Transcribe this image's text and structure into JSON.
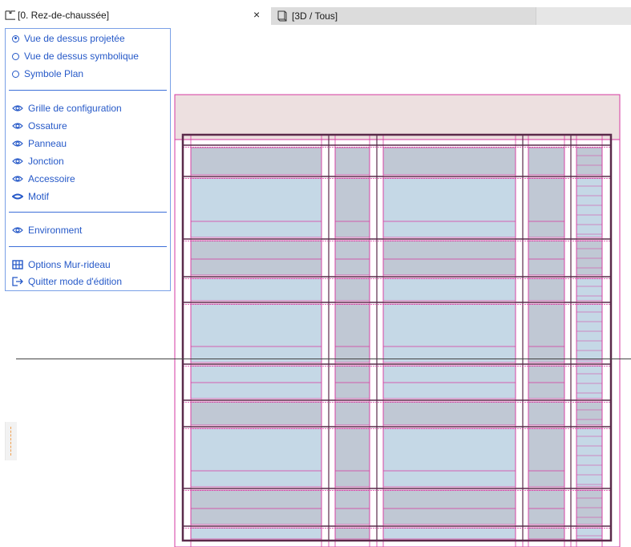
{
  "tabs": {
    "plan_label": "[0. Rez-de-chaussée]",
    "close_glyph": "×",
    "view3d_label": "[3D / Tous]",
    "plan_icon": "floor-plan-icon",
    "view3d_icon": "3d-window-icon"
  },
  "panel": {
    "view_options": [
      {
        "label": "Vue de dessus projetée",
        "selected": true
      },
      {
        "label": "Vue de dessus symbolique",
        "selected": false
      },
      {
        "label": "Symbole Plan",
        "selected": false
      }
    ],
    "visibility_items": [
      {
        "label": "Grille de configuration",
        "icon": "eye-icon"
      },
      {
        "label": "Ossature",
        "icon": "eye-icon"
      },
      {
        "label": "Panneau",
        "icon": "eye-icon"
      },
      {
        "label": "Jonction",
        "icon": "eye-icon"
      },
      {
        "label": "Accessoire",
        "icon": "eye-icon"
      },
      {
        "label": "Motif",
        "icon": "eye-closed-icon"
      }
    ],
    "environment_label": "Environment",
    "options_label": "Options Mur-rideau",
    "exit_label": "Quitter mode d'édition"
  },
  "colors": {
    "accent": "#2659c8",
    "panel_border": "#7aa0e6",
    "grid_line": "#d63aa0",
    "frame_dark": "#5a2a4a",
    "panel_fill": "#c5d8e6",
    "panel_shade": "#c0c8d4",
    "band_fill": "#ede0e0"
  }
}
